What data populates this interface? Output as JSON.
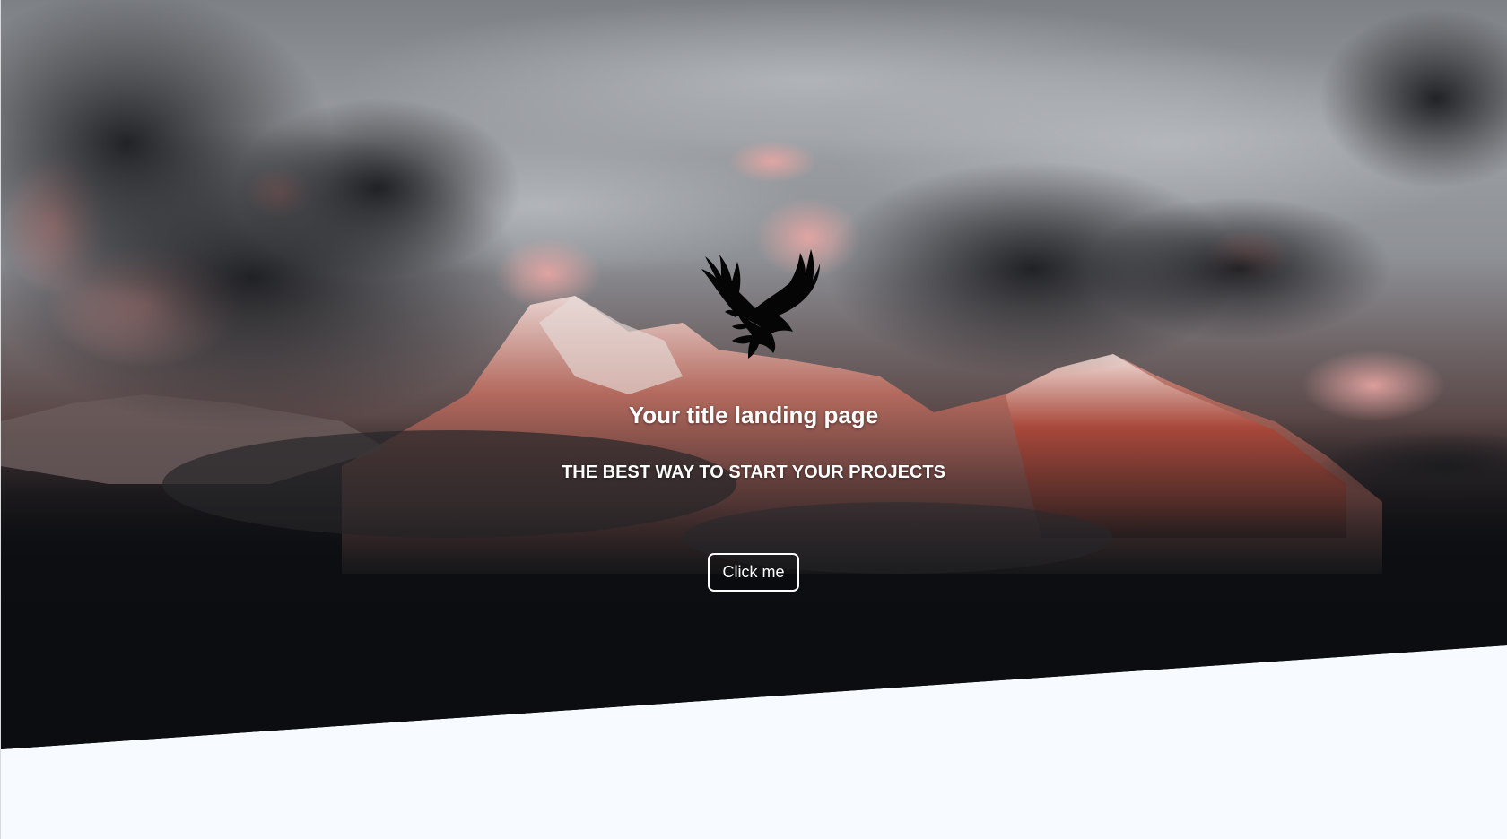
{
  "hero": {
    "logo_icon": "eagle-icon",
    "title": "Your title landing page",
    "subtitle": "THE BEST WAY TO START YOUR PROJECTS",
    "cta_label": "Click me"
  },
  "colors": {
    "text": "#ffffff",
    "page_background": "#f7fbff",
    "hero_dark": "#0b0d10"
  }
}
